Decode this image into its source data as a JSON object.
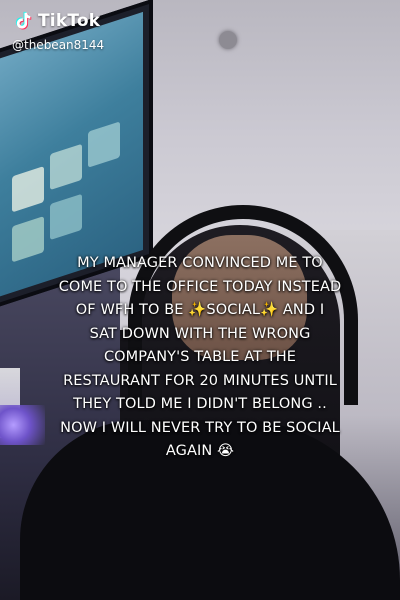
{
  "brand": {
    "name": "TikTok",
    "icon": "tiktok-note-icon",
    "handle": "@thebean8144"
  },
  "caption": {
    "lines": [
      "MY MANAGER CONVINCED ME TO",
      "COME TO THE OFFICE TODAY INSTEAD",
      "OF WFH TO BE ✨SOCIAL✨ AND I",
      "SAT DOWN WITH THE WRONG",
      "COMPANY'S TABLE AT THE",
      "RESTAURANT FOR 20 MINUTES UNTIL",
      "THEY TOLD ME I DIDN'T BELONG ..",
      "NOW I WILL NEVER TRY TO BE SOCIAL",
      "AGAIN 😭"
    ]
  },
  "colors": {
    "caption_text": "#ffffff",
    "brand_text": "#ffffff",
    "tiktok_cyan": "#25F4EE",
    "tiktok_red": "#FE2C55"
  }
}
